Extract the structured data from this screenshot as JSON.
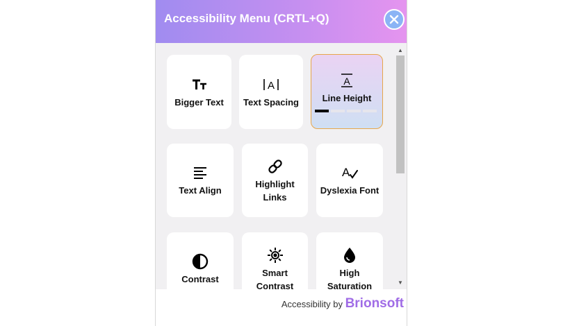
{
  "header": {
    "title": "Accessibility Menu (CRTL+Q)"
  },
  "close": {
    "icon": "close-icon"
  },
  "cards": [
    {
      "id": "bigger-text",
      "label": "Bigger Text",
      "icon": "bigger-text-icon"
    },
    {
      "id": "text-spacing",
      "label": "Text Spacing",
      "icon": "text-spacing-icon"
    },
    {
      "id": "line-height",
      "label": "Line Height",
      "icon": "line-height-icon",
      "active": true,
      "level": 1,
      "levels": 4
    },
    {
      "id": "text-align",
      "label": "Text Align",
      "icon": "text-align-icon"
    },
    {
      "id": "highlight-links",
      "label": "Highlight Links",
      "icon": "link-icon"
    },
    {
      "id": "dyslexia-font",
      "label": "Dyslexia Font",
      "icon": "dyslexia-font-icon"
    },
    {
      "id": "contrast",
      "label": "Contrast",
      "icon": "contrast-icon"
    },
    {
      "id": "smart-contrast",
      "label": "Smart Contrast",
      "icon": "smart-contrast-icon"
    },
    {
      "id": "high-saturation",
      "label": "High Saturation",
      "icon": "droplet-icon"
    }
  ],
  "footer": {
    "prefix": "Accessibility by ",
    "brand": "Brionsoft"
  },
  "colors": {
    "header_start": "#a08cf0",
    "header_end": "#e594ef",
    "active_border": "#e7a64a",
    "brand": "#a06ce6",
    "close_bg": "#8bb4f5"
  }
}
